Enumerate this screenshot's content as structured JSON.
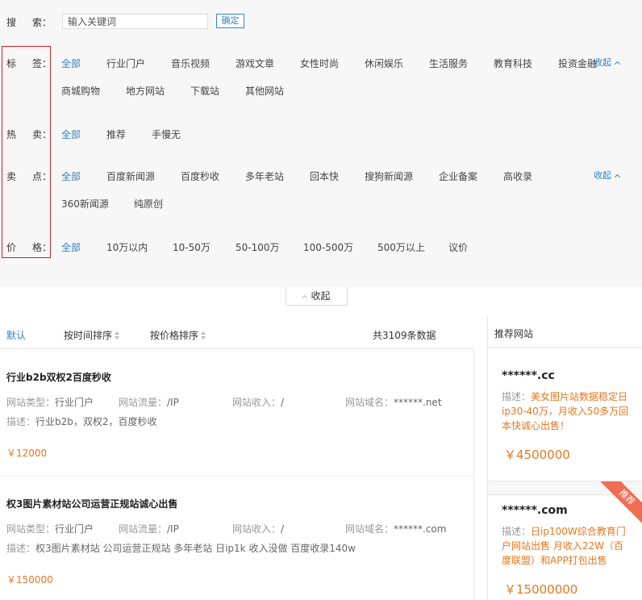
{
  "search": {
    "label_char1": "搜",
    "label_char2": "索：",
    "placeholder": "输入关键词",
    "confirm_label": "确定"
  },
  "filters": {
    "tags": {
      "label_char1": "标",
      "label_char2": "签：",
      "options": [
        "全部",
        "行业门户",
        "音乐视频",
        "游戏文章",
        "女性时尚",
        "休闲娱乐",
        "生活服务",
        "教育科技",
        "投资金融",
        "商城购物",
        "地方网站",
        "下载站",
        "其他网站"
      ],
      "collapse_label": "收起"
    },
    "hot": {
      "label_char1": "热",
      "label_char2": "卖：",
      "options": [
        "全部",
        "推荐",
        "手慢无"
      ]
    },
    "selling_points": {
      "label_char1": "卖",
      "label_char2": "点：",
      "options": [
        "全部",
        "百度新闻源",
        "百度秒收",
        "多年老站",
        "回本快",
        "搜狗新闻源",
        "企业备案",
        "高收录",
        "360新闻源",
        "纯原创"
      ],
      "collapse_label": "收起"
    },
    "price": {
      "label_char1": "价",
      "label_char2": "格：",
      "options": [
        "全部",
        "10万以内",
        "10-50万",
        "50-100万",
        "100-500万",
        "500万以上",
        "议价"
      ]
    },
    "collapse_all_label": "收起"
  },
  "sort": {
    "default_label": "默认",
    "by_time_label": "按时间排序",
    "by_price_label": "按价格排序",
    "total_label": "共3109条数据"
  },
  "listings": [
    {
      "title": "行业b2b双权2百度秒收",
      "type_label": "网站类型：",
      "type_value": "行业门户",
      "traffic_label": "网站流量：",
      "traffic_value": "/IP",
      "income_label": "网站收入：",
      "income_value": "/",
      "domain_label": "网站域名：",
      "domain_value": "******.net",
      "desc_label": "描述：",
      "desc_value": "行业b2b，双权2，百度秒收",
      "price": "￥12000"
    },
    {
      "title": "权3图片素材站公司运营正规站诚心出售",
      "type_label": "网站类型：",
      "type_value": "行业门户",
      "traffic_label": "网站流量：",
      "traffic_value": "/IP",
      "income_label": "网站收入：",
      "income_value": "/",
      "domain_label": "网站域名：",
      "domain_value": "******.com",
      "desc_label": "描述：",
      "desc_value": "权3图片素材站 公司运营正规站 多年老站 日ip1k 收入没做 百度收录140w",
      "price": "￥150000"
    }
  ],
  "sidebar": {
    "title": "推荐网站",
    "cards": [
      {
        "domain": "******.cc",
        "desc_label": "描述：",
        "desc_value": "美女图片站数据稳定日ip30-40万，月收入50多万回本快诚心出售！",
        "price": "￥4500000",
        "badge": ""
      },
      {
        "domain": "******.com",
        "desc_label": "描述：",
        "desc_value": "日ip100W综合教育门户网站出售 月收入22W（百度联盟）和APP打包出售",
        "price": "￥15000000",
        "badge": "推荐"
      }
    ]
  }
}
